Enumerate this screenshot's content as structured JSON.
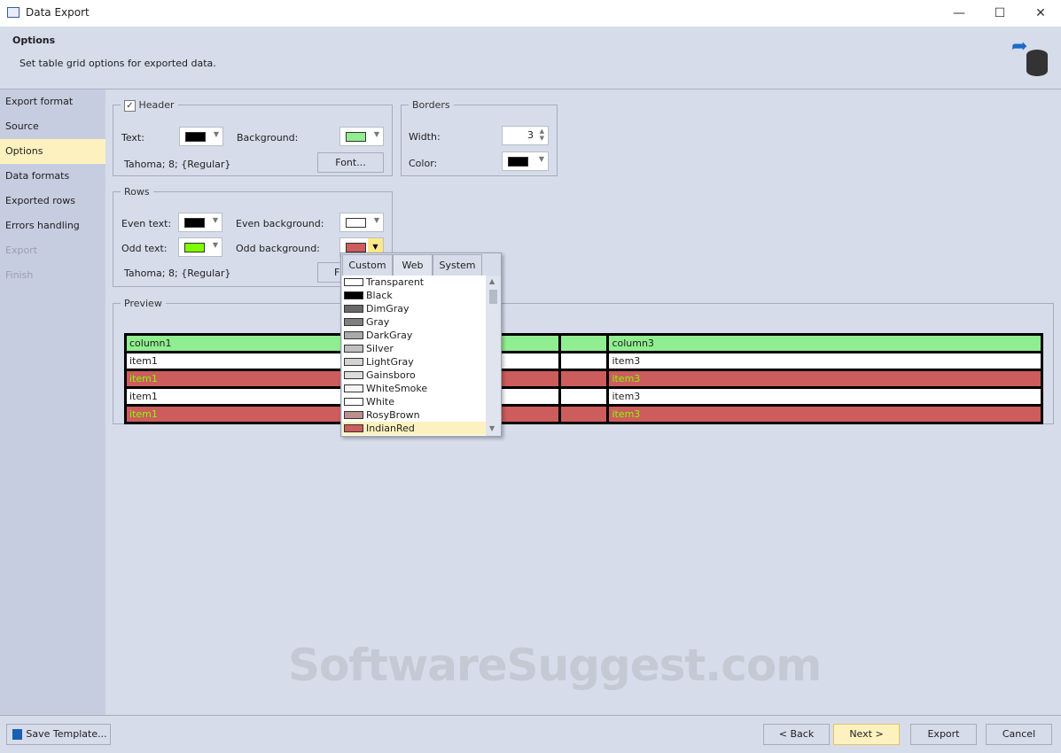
{
  "window": {
    "title": "Data Export",
    "minimize": "—",
    "maximize": "☐",
    "close": "✕"
  },
  "header": {
    "title": "Options",
    "subtitle": "Set table grid options for exported data."
  },
  "sidebar": {
    "items": [
      {
        "label": "Export format",
        "state": "normal"
      },
      {
        "label": "Source",
        "state": "normal"
      },
      {
        "label": "Options",
        "state": "selected"
      },
      {
        "label": "Data formats",
        "state": "normal"
      },
      {
        "label": "Exported rows",
        "state": "normal"
      },
      {
        "label": "Errors handling",
        "state": "normal"
      },
      {
        "label": "Export",
        "state": "disabled"
      },
      {
        "label": "Finish",
        "state": "disabled"
      }
    ]
  },
  "header_group": {
    "legend": "Header",
    "checked": true,
    "text_label": "Text:",
    "text_color": "#000000",
    "bg_label": "Background:",
    "bg_color": "#90ee90",
    "font_desc": "Tahoma; 8; {Regular}",
    "font_button": "Font..."
  },
  "borders": {
    "legend": "Borders",
    "width_label": "Width:",
    "width_value": "3",
    "color_label": "Color:",
    "color": "#000000"
  },
  "rows": {
    "legend": "Rows",
    "even_text_label": "Even text:",
    "even_text_color": "#000000",
    "even_bg_label": "Even background:",
    "even_bg_color": "#ffffff",
    "odd_text_label": "Odd text:",
    "odd_text_color": "#80ff00",
    "odd_bg_label": "Odd background:",
    "odd_bg_color": "#cd5c5c",
    "font_desc": "Tahoma; 8; {Regular}",
    "font_button": "F"
  },
  "preview": {
    "legend": "Preview",
    "header": [
      "column1",
      "",
      "column3"
    ],
    "rows": [
      [
        "item1",
        "",
        "item3"
      ],
      [
        "item1",
        "",
        "item3"
      ],
      [
        "item1",
        "",
        "item3"
      ],
      [
        "item1",
        "",
        "item3"
      ]
    ]
  },
  "dropdown": {
    "tabs": [
      "Custom",
      "Web",
      "System"
    ],
    "active_tab": "Web",
    "items": [
      {
        "name": "Transparent",
        "color": "#ffffff"
      },
      {
        "name": "Black",
        "color": "#000000"
      },
      {
        "name": "DimGray",
        "color": "#696969"
      },
      {
        "name": "Gray",
        "color": "#808080"
      },
      {
        "name": "DarkGray",
        "color": "#a9a9a9"
      },
      {
        "name": "Silver",
        "color": "#c0c0c0"
      },
      {
        "name": "LightGray",
        "color": "#d3d3d3"
      },
      {
        "name": "Gainsboro",
        "color": "#dcdcdc"
      },
      {
        "name": "WhiteSmoke",
        "color": "#f5f5f5"
      },
      {
        "name": "White",
        "color": "#ffffff"
      },
      {
        "name": "RosyBrown",
        "color": "#bc8f8f"
      },
      {
        "name": "IndianRed",
        "color": "#cd5c5c"
      }
    ],
    "selected": "IndianRed"
  },
  "footer": {
    "save_template": "Save Template...",
    "back": "< Back",
    "next": "Next >",
    "export": "Export",
    "cancel": "Cancel"
  },
  "watermark": "SoftwareSuggest.com"
}
